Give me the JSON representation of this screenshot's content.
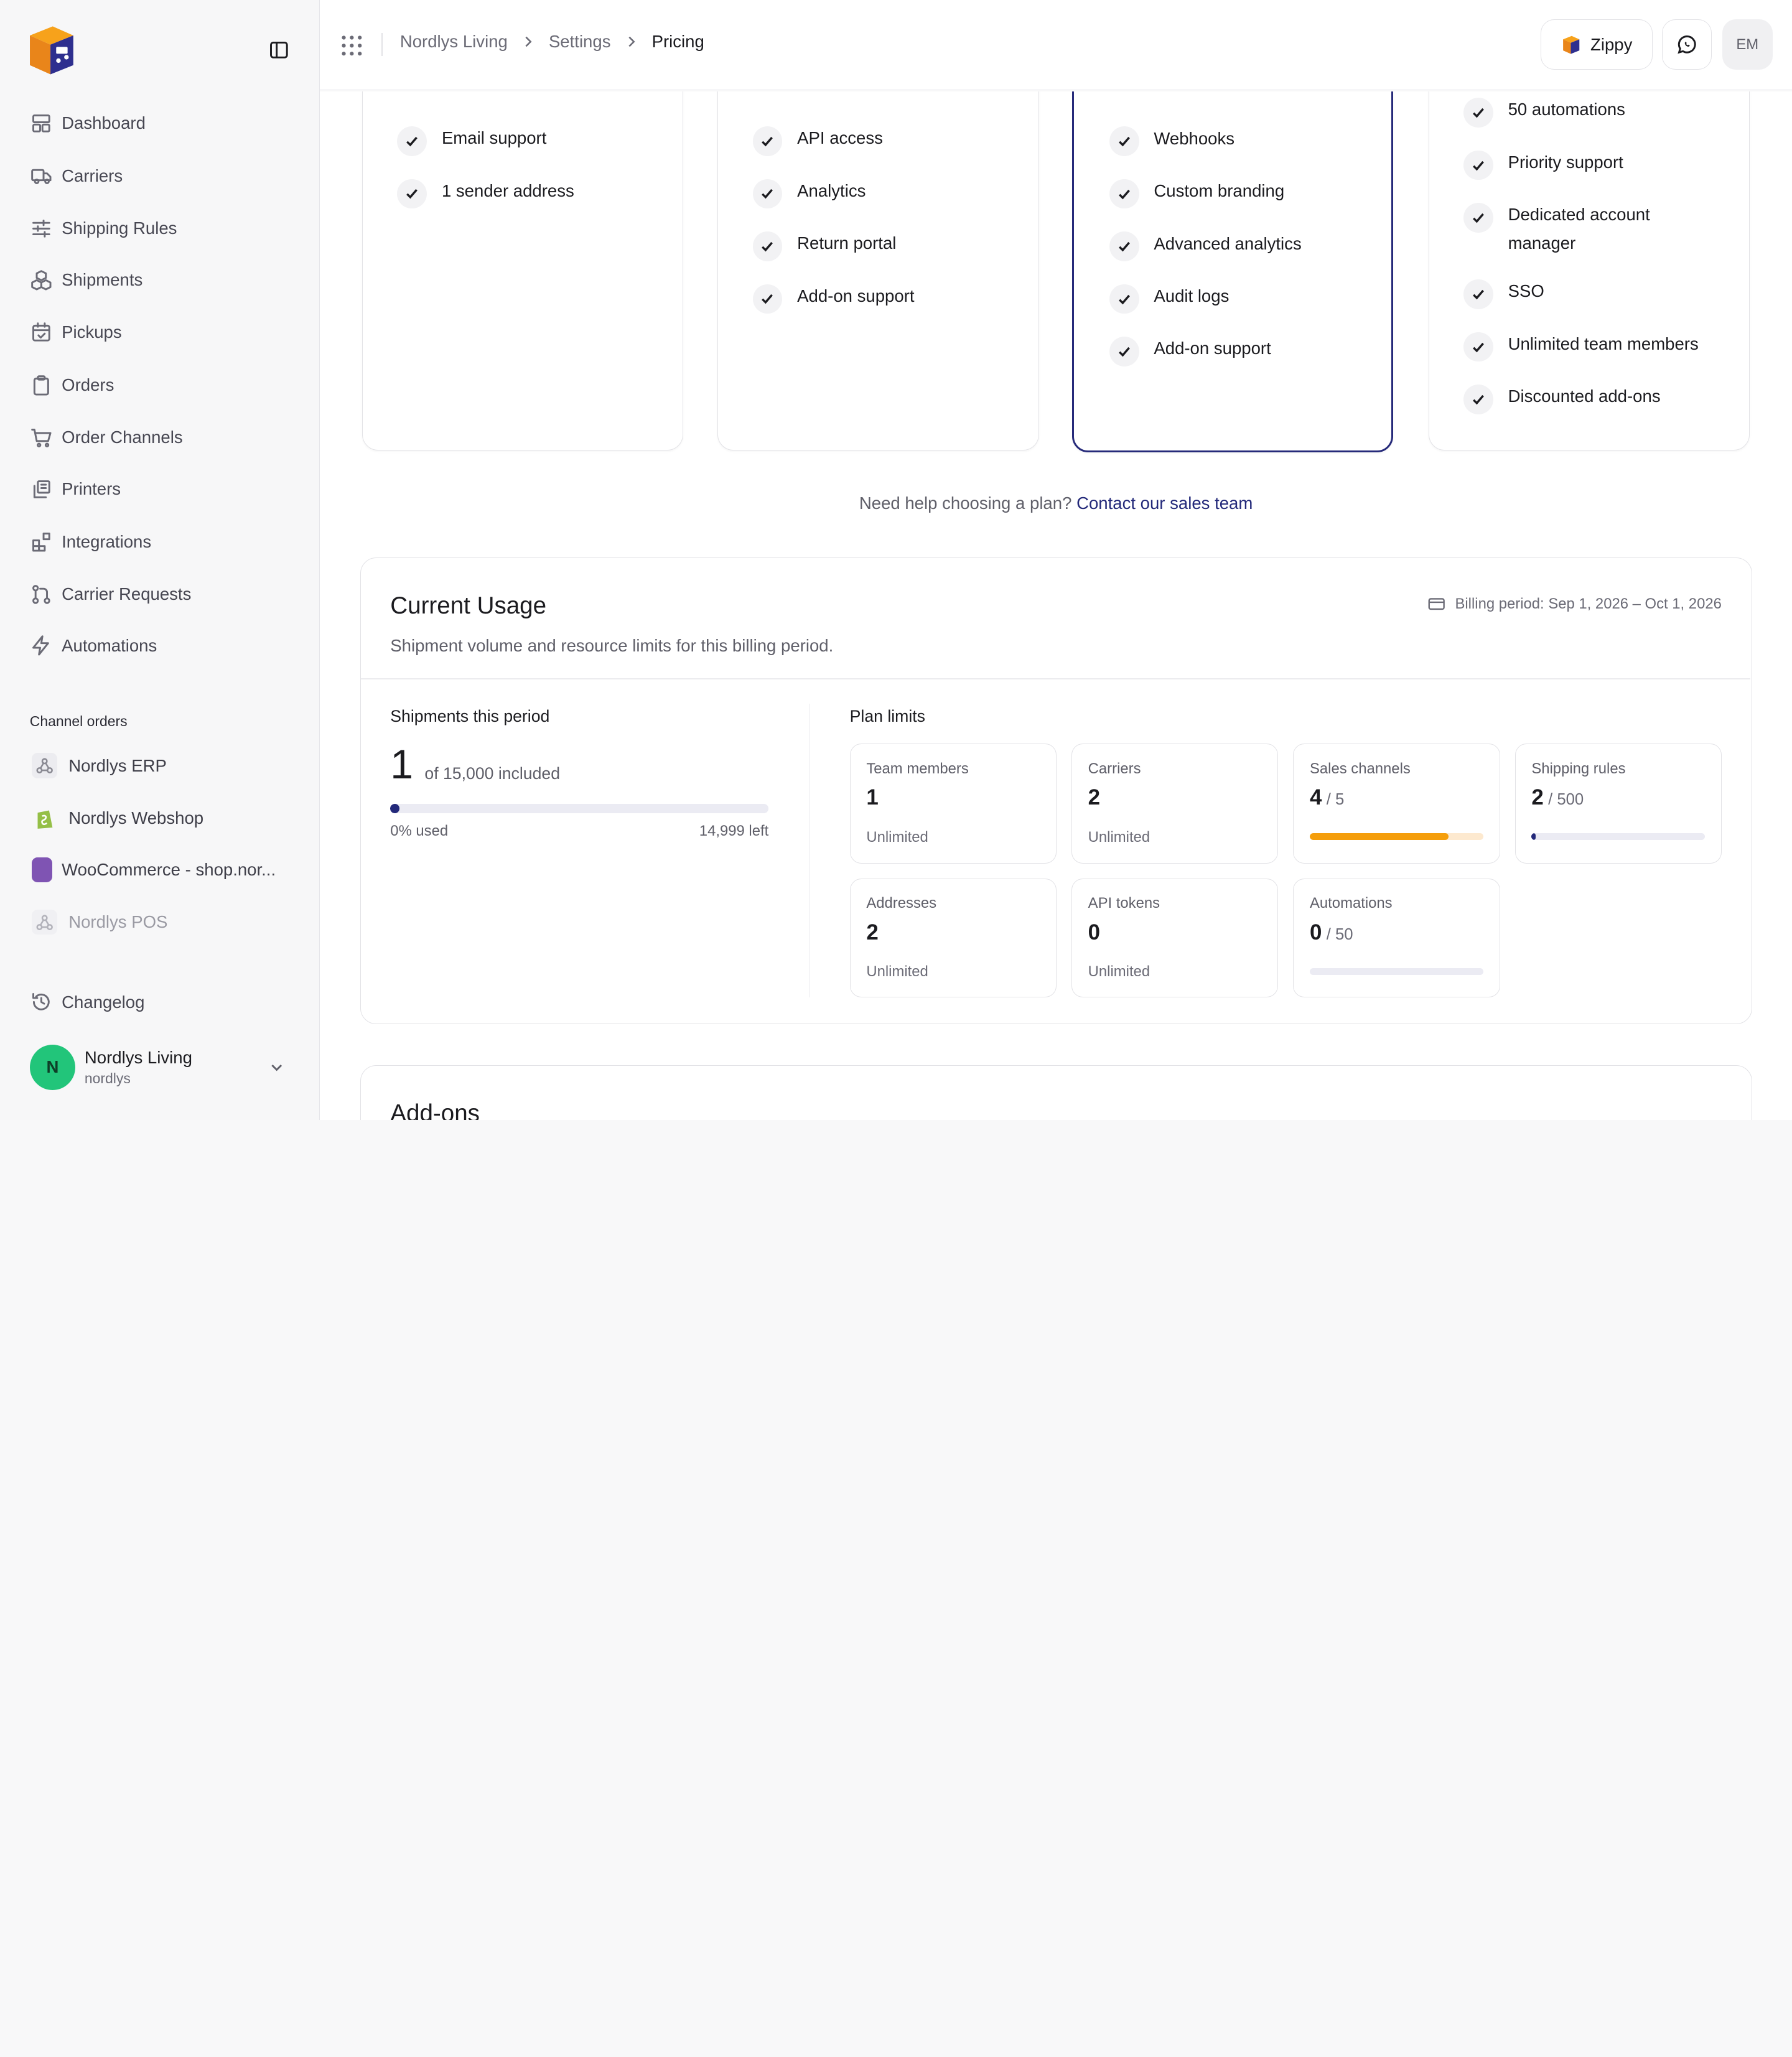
{
  "sidebar": {
    "nav": [
      {
        "label": "Dashboard",
        "icon": "dashboard-icon"
      },
      {
        "label": "Carriers",
        "icon": "truck-icon"
      },
      {
        "label": "Shipping Rules",
        "icon": "sliders-icon"
      },
      {
        "label": "Shipments",
        "icon": "boxes-icon"
      },
      {
        "label": "Pickups",
        "icon": "calendar-icon"
      },
      {
        "label": "Orders",
        "icon": "clipboard-icon"
      },
      {
        "label": "Order Channels",
        "icon": "cart-icon"
      },
      {
        "label": "Printers",
        "icon": "printer-icon"
      },
      {
        "label": "Integrations",
        "icon": "blocks-icon"
      },
      {
        "label": "Carrier Requests",
        "icon": "git-pull-icon"
      },
      {
        "label": "Automations",
        "icon": "bolt-icon"
      }
    ],
    "channels_label": "Channel orders",
    "channels": [
      {
        "label": "Nordlys ERP",
        "icon": "webhook-icon"
      },
      {
        "label": "Nordlys Webshop",
        "icon": "shopify-icon"
      },
      {
        "label": "WooCommerce - shop.nor...",
        "icon": "woocommerce-icon"
      },
      {
        "label": "Nordlys POS",
        "icon": "webhook-icon"
      }
    ],
    "changelog": "Changelog",
    "account": {
      "initial": "N",
      "name": "Nordlys Living",
      "handle": "nordlys"
    }
  },
  "topbar": {
    "breadcrumbs": [
      "Nordlys Living",
      "Settings",
      "Pricing"
    ],
    "zippy_label": "Zippy",
    "avatar_initials": "EM"
  },
  "plans": [
    {
      "features": [
        "Email support",
        "1 sender address"
      ]
    },
    {
      "features": [
        "API access",
        "Analytics",
        "Return portal",
        "Add-on support"
      ]
    },
    {
      "features": [
        "Webhooks",
        "Custom branding",
        "Advanced analytics",
        "Audit logs",
        "Add-on support"
      ]
    },
    {
      "features": [
        "50 automations",
        "Priority support",
        "Dedicated account manager",
        "SSO",
        "Unlimited team members",
        "Discounted add-ons"
      ]
    }
  ],
  "help": {
    "text": "Need help choosing a plan?",
    "link": "Contact our sales team"
  },
  "usage": {
    "title": "Current Usage",
    "subtitle": "Shipment volume and resource limits for this billing period.",
    "billing_period": "Billing period: Sep 1, 2026 – Oct 1, 2026",
    "shipments": {
      "label": "Shipments this period",
      "count": "1",
      "included": "of 15,000 included",
      "used_text": "0% used",
      "left_text": "14,999 left",
      "used_fraction": 0.0001
    },
    "limits_label": "Plan limits",
    "limits": [
      {
        "name": "Team members",
        "value": "1",
        "note": "Unlimited"
      },
      {
        "name": "Carriers",
        "value": "2",
        "note": "Unlimited"
      },
      {
        "name": "Sales channels",
        "value": "4",
        "max": "/ 5",
        "fraction": 0.8,
        "color": "#f59e0b"
      },
      {
        "name": "Shipping rules",
        "value": "2",
        "max": "/ 500",
        "fraction": 0.004,
        "color": "#23297a"
      },
      {
        "name": "Addresses",
        "value": "2",
        "note": "Unlimited"
      },
      {
        "name": "API tokens",
        "value": "0",
        "note": "Unlimited"
      },
      {
        "name": "Automations",
        "value": "0",
        "max": "/ 50",
        "fraction": 0,
        "color": "#23297a"
      }
    ]
  },
  "addons": {
    "title": "Add-ons"
  },
  "colors": {
    "accent": "#23297a",
    "success": "#22c57a",
    "warning": "#f59e0b"
  }
}
